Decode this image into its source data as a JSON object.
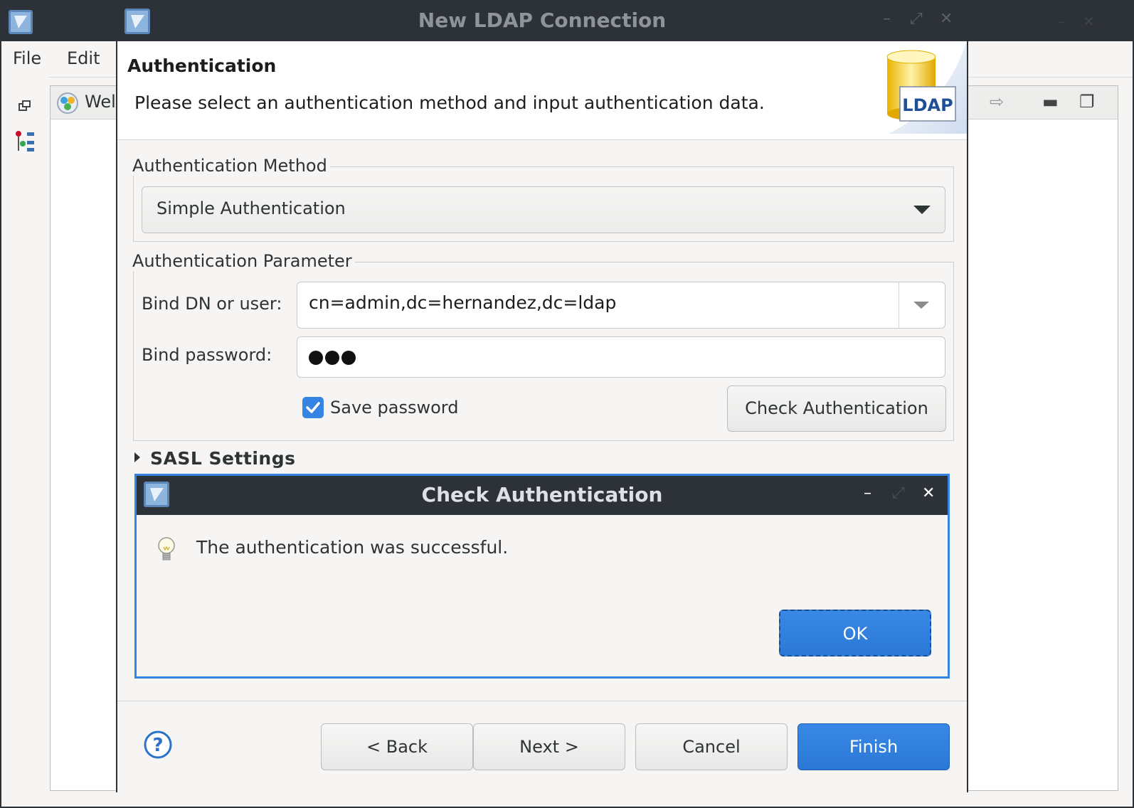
{
  "background_window": {
    "menu": [
      "File",
      "Edit"
    ],
    "tab_label": "Wel"
  },
  "dialog": {
    "title": "New LDAP Connection",
    "banner": {
      "title": "Authentication",
      "description": "Please select an authentication method and input authentication data.",
      "logo_text": "LDAP"
    },
    "auth_method": {
      "legend": "Authentication Method",
      "selected": "Simple Authentication"
    },
    "auth_param": {
      "legend": "Authentication Parameter",
      "bind_dn_label": "Bind DN or user:",
      "bind_dn_value": "cn=admin,dc=hernandez,dc=ldap",
      "bind_password_label": "Bind password:",
      "password_length": 3,
      "save_password_label": "Save password",
      "save_password_checked": true,
      "check_button": "Check Authentication"
    },
    "sasl_label": "SASL Settings",
    "buttons": {
      "back": "< Back",
      "next": "Next >",
      "cancel": "Cancel",
      "finish": "Finish"
    }
  },
  "message_dialog": {
    "title": "Check Authentication",
    "message": "The authentication was successful.",
    "ok": "OK"
  },
  "colors": {
    "titlebar": "#2d3138",
    "accent": "#3584e4",
    "window_bg": "#f6f5f4"
  },
  "icons": [
    "app-icon",
    "help-icon",
    "lightbulb-icon",
    "ldap-database-icon",
    "minimize-icon",
    "maximize-icon",
    "close-icon",
    "dropdown-arrow-icon",
    "checkmark-icon"
  ]
}
